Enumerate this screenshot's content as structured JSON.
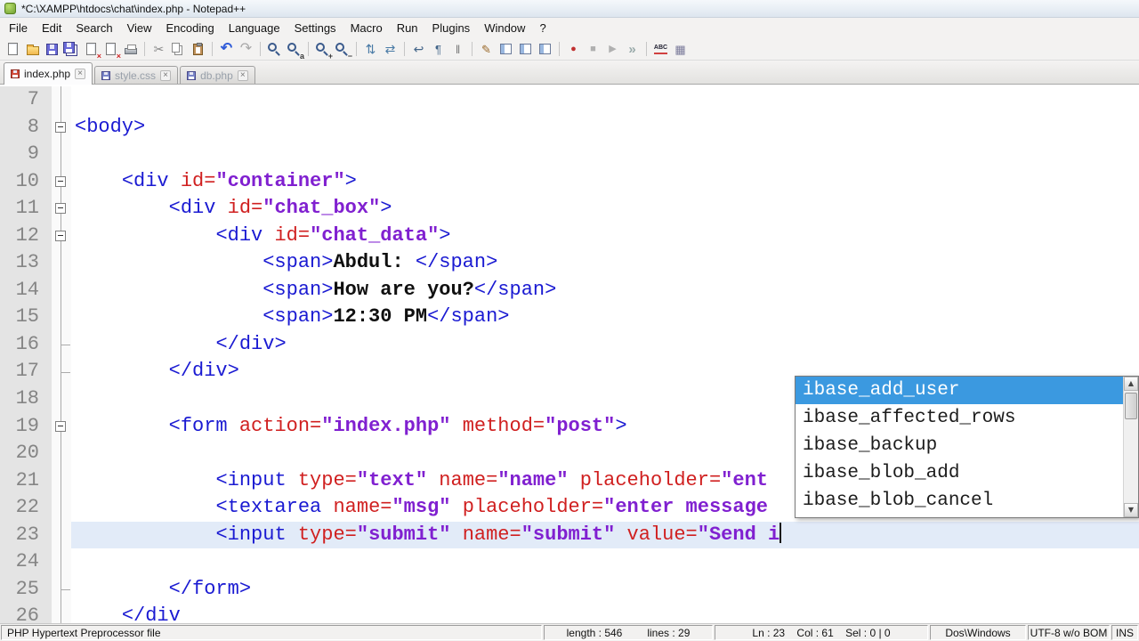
{
  "window": {
    "title": "*C:\\XAMPP\\htdocs\\chat\\index.php - Notepad++"
  },
  "colors": {
    "tag": "#1a1ad2",
    "attribute": "#d02020",
    "value": "#8020d0",
    "text_bold": "#101010",
    "current_line_bg": "#e2ebf8",
    "selection_bg": "#3b99e0",
    "selection_text": "#ffffff",
    "line_number": "#858585",
    "modified_indicator": "#d04a3a",
    "saved_indicator": "#7a86c8"
  },
  "menu_bar": {
    "items": [
      "File",
      "Edit",
      "Search",
      "View",
      "Encoding",
      "Language",
      "Settings",
      "Macro",
      "Run",
      "Plugins",
      "Window",
      "?"
    ]
  },
  "toolbar": {
    "groups": [
      [
        "new-file",
        "open-file",
        "save",
        "save-all",
        "close",
        "close-all",
        "print"
      ],
      [
        "cut",
        "copy",
        "paste"
      ],
      [
        "undo",
        "redo"
      ],
      [
        "find",
        "replace"
      ],
      [
        "zoom-in",
        "zoom-out"
      ],
      [
        "sync-vertical-scrolling",
        "sync-horizontal-scrolling"
      ],
      [
        "word-wrap",
        "show-all-characters",
        "indent-guide"
      ],
      [
        "user-defined-dialog",
        "function-list",
        "document-map",
        "document-list"
      ],
      [
        "macro-record",
        "macro-stop",
        "macro-playback",
        "macro-run-multiple"
      ],
      [
        "spell-check",
        "plugins-admin"
      ]
    ]
  },
  "tab_bar": {
    "tabs": [
      {
        "label": "index.php",
        "active": true,
        "modified": true
      },
      {
        "label": "style.css",
        "active": false,
        "modified": false
      },
      {
        "label": "db.php",
        "active": false,
        "modified": false
      }
    ]
  },
  "editor": {
    "current_line": 23,
    "lines": [
      {
        "num": 7,
        "fold": "v",
        "tokens": []
      },
      {
        "num": 8,
        "fold": "box",
        "tokens": [
          {
            "t": "tag",
            "v": "<body>"
          }
        ]
      },
      {
        "num": 9,
        "fold": "v",
        "tokens": []
      },
      {
        "num": 10,
        "fold": "box",
        "tokens": [
          {
            "t": "pln",
            "v": "    "
          },
          {
            "t": "tag",
            "v": "<div "
          },
          {
            "t": "attr",
            "v": "id="
          },
          {
            "t": "val",
            "v": "\"container\""
          },
          {
            "t": "tag",
            "v": ">"
          }
        ]
      },
      {
        "num": 11,
        "fold": "box",
        "tokens": [
          {
            "t": "pln",
            "v": "        "
          },
          {
            "t": "tag",
            "v": "<div "
          },
          {
            "t": "attr",
            "v": "id="
          },
          {
            "t": "val",
            "v": "\"chat_box\""
          },
          {
            "t": "tag",
            "v": ">"
          }
        ]
      },
      {
        "num": 12,
        "fold": "box",
        "tokens": [
          {
            "t": "pln",
            "v": "            "
          },
          {
            "t": "tag",
            "v": "<div "
          },
          {
            "t": "attr",
            "v": "id="
          },
          {
            "t": "val",
            "v": "\"chat_data\""
          },
          {
            "t": "tag",
            "v": ">"
          }
        ]
      },
      {
        "num": 13,
        "fold": "v",
        "tokens": [
          {
            "t": "pln",
            "v": "                "
          },
          {
            "t": "tag",
            "v": "<span>"
          },
          {
            "t": "txt",
            "v": "Abdul: "
          },
          {
            "t": "tag",
            "v": "</span>"
          }
        ]
      },
      {
        "num": 14,
        "fold": "v",
        "tokens": [
          {
            "t": "pln",
            "v": "                "
          },
          {
            "t": "tag",
            "v": "<span>"
          },
          {
            "t": "txt",
            "v": "How are you?"
          },
          {
            "t": "tag",
            "v": "</span>"
          }
        ]
      },
      {
        "num": 15,
        "fold": "v",
        "tokens": [
          {
            "t": "pln",
            "v": "                "
          },
          {
            "t": "tag",
            "v": "<span>"
          },
          {
            "t": "txt",
            "v": "12:30 PM"
          },
          {
            "t": "tag",
            "v": "</span>"
          }
        ]
      },
      {
        "num": 16,
        "fold": "end",
        "tokens": [
          {
            "t": "pln",
            "v": "            "
          },
          {
            "t": "tag",
            "v": "</div>"
          }
        ]
      },
      {
        "num": 17,
        "fold": "end",
        "tokens": [
          {
            "t": "pln",
            "v": "        "
          },
          {
            "t": "tag",
            "v": "</div>"
          }
        ]
      },
      {
        "num": 18,
        "fold": "v",
        "tokens": []
      },
      {
        "num": 19,
        "fold": "box",
        "tokens": [
          {
            "t": "pln",
            "v": "        "
          },
          {
            "t": "tag",
            "v": "<form "
          },
          {
            "t": "attr",
            "v": "action="
          },
          {
            "t": "val",
            "v": "\"index.php\""
          },
          {
            "t": "pln",
            "v": " "
          },
          {
            "t": "attr",
            "v": "method="
          },
          {
            "t": "val",
            "v": "\"post\""
          },
          {
            "t": "tag",
            "v": ">"
          }
        ]
      },
      {
        "num": 20,
        "fold": "v",
        "tokens": []
      },
      {
        "num": 21,
        "fold": "v",
        "tokens": [
          {
            "t": "pln",
            "v": "            "
          },
          {
            "t": "tag",
            "v": "<input "
          },
          {
            "t": "attr",
            "v": "type="
          },
          {
            "t": "val",
            "v": "\"text\""
          },
          {
            "t": "pln",
            "v": " "
          },
          {
            "t": "attr",
            "v": "name="
          },
          {
            "t": "val",
            "v": "\"name\""
          },
          {
            "t": "pln",
            "v": " "
          },
          {
            "t": "attr",
            "v": "placeholder="
          },
          {
            "t": "val",
            "v": "\"ent"
          }
        ]
      },
      {
        "num": 22,
        "fold": "v",
        "tokens": [
          {
            "t": "pln",
            "v": "            "
          },
          {
            "t": "tag",
            "v": "<textarea "
          },
          {
            "t": "attr",
            "v": "name="
          },
          {
            "t": "val",
            "v": "\"msg\""
          },
          {
            "t": "pln",
            "v": " "
          },
          {
            "t": "attr",
            "v": "placeholder="
          },
          {
            "t": "val",
            "v": "\"enter message"
          }
        ]
      },
      {
        "num": 23,
        "fold": "v",
        "current": true,
        "caret": true,
        "tokens": [
          {
            "t": "pln",
            "v": "            "
          },
          {
            "t": "tag",
            "v": "<input "
          },
          {
            "t": "attr",
            "v": "type="
          },
          {
            "t": "val",
            "v": "\"submit\""
          },
          {
            "t": "pln",
            "v": " "
          },
          {
            "t": "attr",
            "v": "name="
          },
          {
            "t": "val",
            "v": "\"submit\""
          },
          {
            "t": "pln",
            "v": " "
          },
          {
            "t": "attr",
            "v": "value="
          },
          {
            "t": "val",
            "v": "\"Send i"
          }
        ]
      },
      {
        "num": 24,
        "fold": "v",
        "tokens": []
      },
      {
        "num": 25,
        "fold": "end",
        "tokens": [
          {
            "t": "pln",
            "v": "        "
          },
          {
            "t": "tag",
            "v": "</form>"
          }
        ]
      },
      {
        "num": 26,
        "fold": "v",
        "tokens": [
          {
            "t": "pln",
            "v": "    "
          },
          {
            "t": "tag",
            "v": "</div"
          }
        ]
      }
    ]
  },
  "autocomplete": {
    "selected_index": 0,
    "items": [
      "ibase_add_user",
      "ibase_affected_rows",
      "ibase_backup",
      "ibase_blob_add",
      "ibase_blob_cancel"
    ]
  },
  "statusbar": {
    "doctype": "PHP Hypertext Preprocessor file",
    "length_label": "length : 546",
    "lines_label": "lines : 29",
    "position": "Ln : 23    Col : 61    Sel : 0 | 0",
    "eol": "Dos\\Windows",
    "encoding": "UTF-8 w/o BOM",
    "insert_mode": "INS"
  }
}
